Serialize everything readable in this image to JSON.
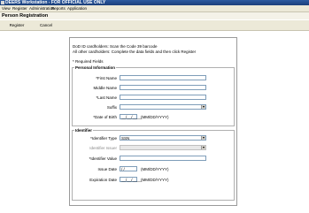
{
  "window": {
    "title": "DEERS Workstation - FOR OFFICIAL USE ONLY"
  },
  "menu": {
    "items": [
      "View",
      "Register",
      "Administration",
      "Reports",
      "Application"
    ]
  },
  "page": {
    "title": "Person Registration"
  },
  "toolbar": {
    "register_label": "Register",
    "cancel_label": "Cancel"
  },
  "form": {
    "intro_line1": "DoD ID cardholders: Scan the Code 39 barcode",
    "intro_line2": "All other cardholders: Complete the data fields and then click Register",
    "required_note": "* Required Fields",
    "personal": {
      "legend": "Personal Information",
      "first_name_label": "*First Name",
      "middle_name_label": "Middle Name",
      "last_name_label": "*Last Name",
      "suffix_label": "Suffix",
      "dob_label": "*Date of Birth",
      "dob_placeholder": "__/__/____",
      "dob_hint": "(MM/DD/YYYY)"
    },
    "identifier": {
      "legend": "Identifier",
      "type_label": "*Identifier Type",
      "type_value": "SSN",
      "issuer_label": "Identifier Issuer",
      "value_label": "*Identifier Value",
      "issue_date_label": "Issue Date",
      "issue_date_placeholder": "/  /",
      "issue_date_hint": "(MM/DD/YYYY)",
      "expiration_label": "Expiration Date",
      "expiration_placeholder": "__/__/____",
      "expiration_hint": "(MM/DD/YYYY)"
    }
  }
}
